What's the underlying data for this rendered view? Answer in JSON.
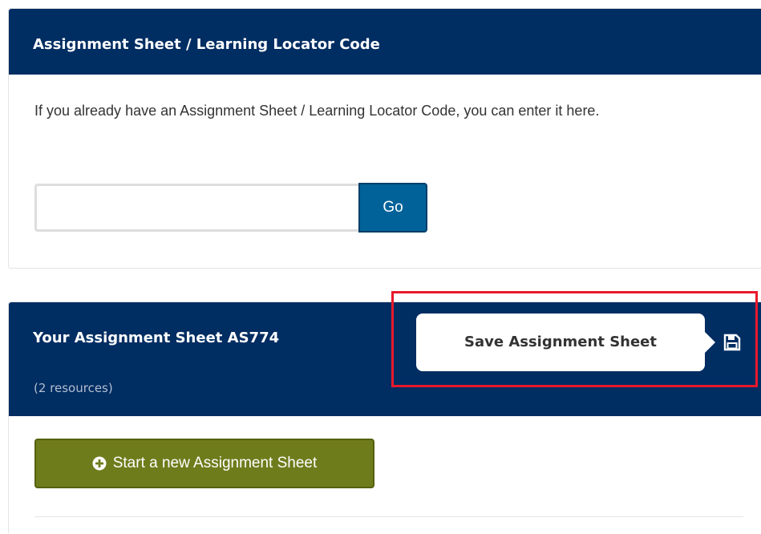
{
  "locator_panel": {
    "title": "Assignment Sheet / Learning Locator Code",
    "description": "If you already have an Assignment Sheet / Learning Locator Code, you can enter it here.",
    "input_value": "",
    "input_placeholder": "",
    "go_label": "Go"
  },
  "sheet_panel": {
    "title": "Your Assignment Sheet AS774",
    "subtitle": "(2 resources)",
    "tooltip": "Save Assignment Sheet",
    "save_icon": "floppy-disk-icon",
    "start_label": "Start a new Assignment Sheet",
    "start_icon": "plus-circle-icon"
  },
  "colors": {
    "header_bg": "#002d62",
    "go_button": "#006299",
    "start_button": "#6f7c1c",
    "highlight": "#e8192c"
  }
}
